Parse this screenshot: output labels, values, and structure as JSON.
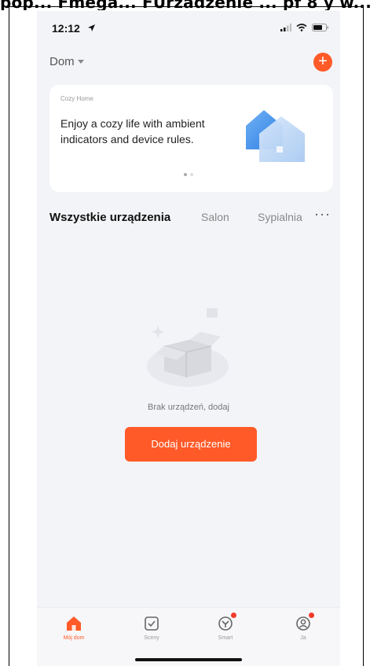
{
  "top_caption": "pop... Fmega... FUrzadzenie ... pf 8 y w...",
  "status_bar": {
    "time": "12:12"
  },
  "header": {
    "home_name": "Dom"
  },
  "banner": {
    "tag": "Cozy Home",
    "text": "Enjoy a cozy life with ambient indicators and device rules."
  },
  "tabs": {
    "items": [
      "Wszystkie urządzenia",
      "Salon",
      "Sypialnia"
    ],
    "more": "···"
  },
  "empty_state": {
    "message": "Brak urządzeń, dodaj",
    "button_label": "Dodaj urządzenie"
  },
  "bottom_nav": {
    "items": [
      {
        "label": "Mój dom",
        "icon": "home-icon"
      },
      {
        "label": "Sceny",
        "icon": "scenes-icon"
      },
      {
        "label": "Smart",
        "icon": "smart-icon"
      },
      {
        "label": "Ja",
        "icon": "profile-icon"
      }
    ]
  },
  "colors": {
    "accent": "#ff5a28",
    "background": "#f3f4f7",
    "badge": "#f23a2c"
  }
}
